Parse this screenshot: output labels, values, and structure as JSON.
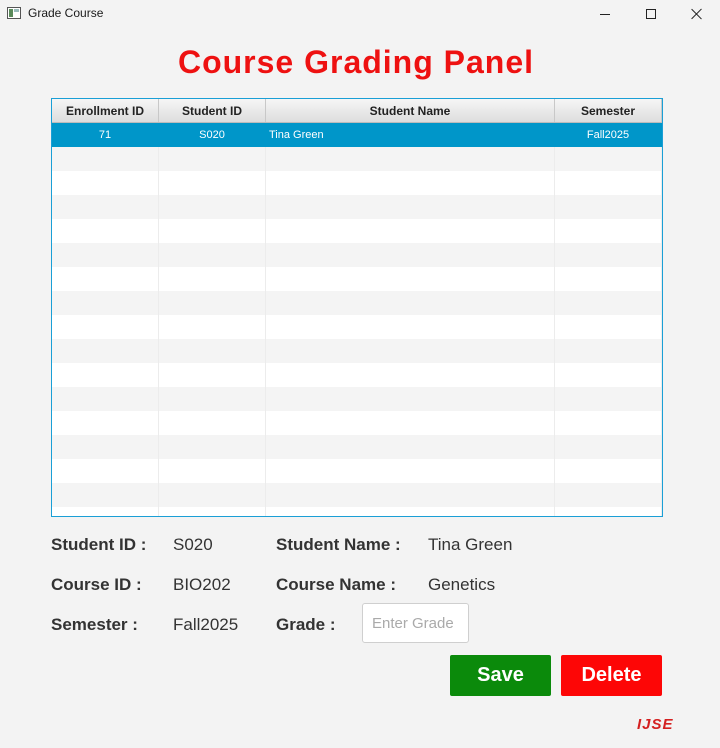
{
  "window": {
    "title": "Grade Course"
  },
  "page": {
    "title": "Course Grading Panel"
  },
  "table": {
    "columns": [
      "Enrollment ID",
      "Student ID",
      "Student Name",
      "Semester"
    ],
    "rows": [
      {
        "enrollment_id": "71",
        "student_id": "S020",
        "student_name": "Tina Green",
        "semester": "Fall2025",
        "selected": true
      }
    ]
  },
  "details": {
    "student_id_label": "Student ID :",
    "student_id_value": "S020",
    "student_name_label": "Student Name :",
    "student_name_value": "Tina Green",
    "course_id_label": "Course ID :",
    "course_id_value": "BIO202",
    "course_name_label": "Course Name :",
    "course_name_value": "Genetics",
    "semester_label": "Semester :",
    "semester_value": "Fall2025",
    "grade_label": "Grade :",
    "grade_value": "",
    "grade_placeholder": "Enter Grade"
  },
  "actions": {
    "save_label": "Save",
    "delete_label": "Delete"
  },
  "logo": {
    "text": "IJSE"
  },
  "colors": {
    "title": "#ee1111",
    "selection": "#0096c9",
    "save": "#0b8a0b",
    "delete": "#fd0606"
  }
}
